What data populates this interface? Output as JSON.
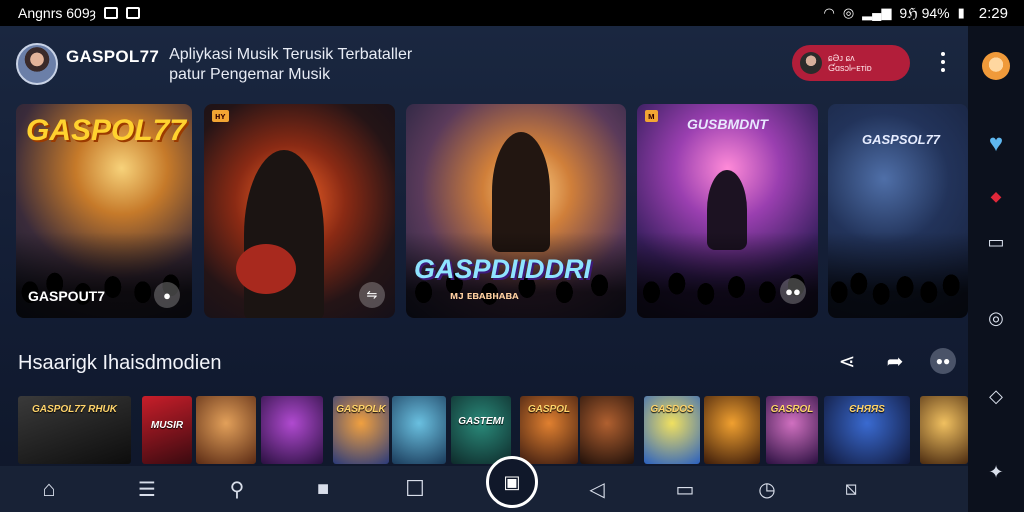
{
  "status_bar": {
    "left_text": "Angnrs 609ȝ",
    "right_text": "9ℌ 94%",
    "time": "2:29"
  },
  "header": {
    "brand": "GASPOL77",
    "tagline_line1": "Apliykasi Musik Terusik Terbataller",
    "tagline_line2": "patur Pengemar Musik",
    "profile_pill_line1": "ɕƏᴊ ɕᴧ",
    "profile_pill_line2": "Ɠɑsɔl⌐ᴇᴛiᴅ"
  },
  "hero_cards": [
    {
      "title": "GASPOL77",
      "subtitle": "GASPOUT7",
      "badge": ""
    },
    {
      "title": "",
      "subtitle": "",
      "badge": "ʜʏ"
    },
    {
      "title": "GASPDIIDDRI",
      "subtitle": "ᴍᴊ ᴇʙᴀʙʜᴀʙᴀ",
      "badge": ""
    },
    {
      "title": "GUSBMDNT",
      "subtitle": "",
      "badge": "ᴍ"
    },
    {
      "title": "GASPSOL77",
      "subtitle": "",
      "badge": ""
    }
  ],
  "section": {
    "title": "Hsaarigk Ihaisdmodien"
  },
  "thumbnails": [
    {
      "label": "GASPOL77 RHUK"
    },
    {
      "label": "MUSIR"
    },
    {
      "label": ""
    },
    {
      "label": ""
    },
    {
      "label": "GASPOLK"
    },
    {
      "label": ""
    },
    {
      "label": "GASTEMI"
    },
    {
      "label": "GASPOL"
    },
    {
      "label": ""
    },
    {
      "label": "GASDOS"
    },
    {
      "label": ""
    },
    {
      "label": "GASROL"
    },
    {
      "label": "ЄНЯЯS"
    },
    {
      "label": ""
    }
  ],
  "colors": {
    "accent": "#b21e3a",
    "background": "#121c33",
    "rail": "#0c111d"
  },
  "icons": {
    "nav": [
      "home-icon",
      "list-icon",
      "search-icon",
      "square-icon",
      "box-icon",
      "shop-icon",
      "back-icon",
      "tv-icon",
      "clock-icon",
      "download-icon"
    ],
    "rail": [
      "avatar-icon",
      "heart-icon",
      "diamond-icon",
      "chat-icon",
      "disc-icon",
      "shape-icon",
      "puzzle-icon"
    ]
  }
}
